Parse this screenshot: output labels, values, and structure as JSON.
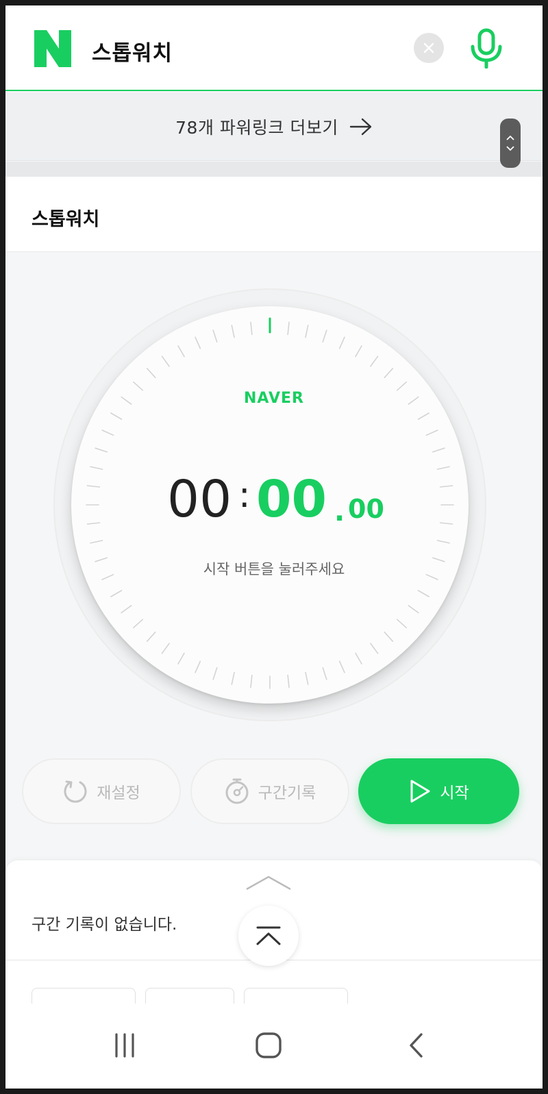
{
  "header": {
    "search_query": "스톱워치",
    "logo_letter": "N",
    "clear_icon": "close-icon",
    "mic_icon": "microphone-icon"
  },
  "powerlink": {
    "label": "78개 파워링크 더보기"
  },
  "title": "스톱워치",
  "stopwatch": {
    "brand": "NAVER",
    "minutes": "00",
    "colon": ":",
    "seconds": "00",
    "dot": ".",
    "centiseconds": "00",
    "hint": "시작 버튼을 눌러주세요"
  },
  "buttons": {
    "reset": "재설정",
    "lap": "구간기록",
    "start": "시작"
  },
  "records": {
    "empty": "구간 기록이 없습니다."
  },
  "colors": {
    "accent": "#19ce60",
    "text": "#222222",
    "disabled": "#b9b9b9"
  }
}
